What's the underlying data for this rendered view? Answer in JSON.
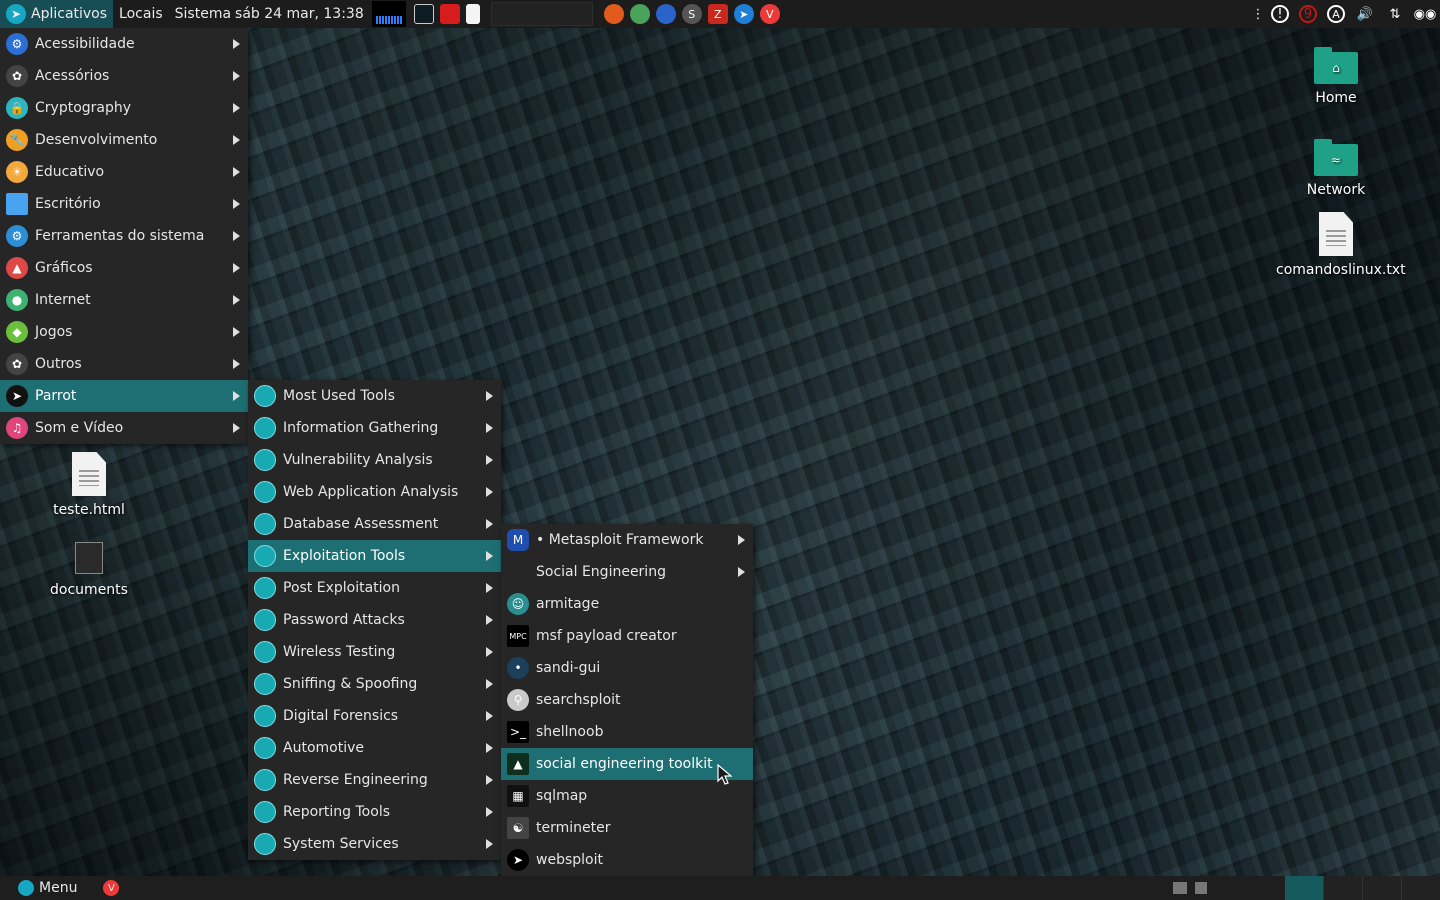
{
  "top_panel": {
    "apps_label": "Aplicativos",
    "places_label": "Locais",
    "system_label": "Sistema",
    "clock": "sáb 24 mar, 13:38",
    "launchers": [
      "firefox-icon",
      "globe-icon",
      "network-icon",
      "s-icon",
      "filezilla-icon",
      "shuttle-icon",
      "vivaldi-icon"
    ],
    "tray": [
      "more-icon",
      "info-icon",
      "notification-icon",
      "accessibility-icon",
      "volume-icon",
      "network-arrows-icon",
      "user-icon"
    ],
    "tray_badge": "9"
  },
  "main_menu": {
    "items": [
      {
        "label": "Acessibilidade",
        "icon": "accessibility-icon",
        "color": "#2a6fd6"
      },
      {
        "label": "Acessórios",
        "icon": "accessories-icon",
        "color": "#444"
      },
      {
        "label": "Cryptography",
        "icon": "lock-icon",
        "color": "#2bb5c0"
      },
      {
        "label": "Desenvolvimento",
        "icon": "wrench-icon",
        "color": "#f0a020"
      },
      {
        "label": "Educativo",
        "icon": "education-icon",
        "color": "#f3a83c"
      },
      {
        "label": "Escritório",
        "icon": "document-icon",
        "color": "#4aa3f0"
      },
      {
        "label": "Ferramentas do sistema",
        "icon": "gear-icon",
        "color": "#2b8ed6"
      },
      {
        "label": "Gráficos",
        "icon": "graphics-icon",
        "color": "#e04848"
      },
      {
        "label": "Internet",
        "icon": "globe-icon",
        "color": "#3cb371"
      },
      {
        "label": "Jogos",
        "icon": "gamepad-icon",
        "color": "#6cbf3c"
      },
      {
        "label": "Outros",
        "icon": "other-icon",
        "color": "#444"
      },
      {
        "label": "Parrot",
        "icon": "parrot-icon",
        "color": "#111"
      },
      {
        "label": "Som e Vídeo",
        "icon": "music-icon",
        "color": "#e0457b"
      }
    ]
  },
  "parrot_menu": {
    "items": [
      {
        "label": "Most Used Tools"
      },
      {
        "label": "Information Gathering"
      },
      {
        "label": "Vulnerability Analysis"
      },
      {
        "label": "Web Application Analysis"
      },
      {
        "label": "Database Assessment"
      },
      {
        "label": "Exploitation Tools"
      },
      {
        "label": "Post Exploitation"
      },
      {
        "label": "Password Attacks"
      },
      {
        "label": "Wireless Testing"
      },
      {
        "label": "Sniffing & Spoofing"
      },
      {
        "label": "Digital Forensics"
      },
      {
        "label": "Automotive"
      },
      {
        "label": "Reverse Engineering"
      },
      {
        "label": "Reporting Tools"
      },
      {
        "label": "System Services"
      }
    ]
  },
  "exploitation_menu": {
    "items": [
      {
        "label": "• Metasploit Framework",
        "icon": "metasploit-icon",
        "submenu": true
      },
      {
        "label": "Social Engineering",
        "icon": "",
        "submenu": true
      },
      {
        "label": "armitage",
        "icon": "armitage-icon",
        "submenu": false
      },
      {
        "label": "msf payload creator",
        "icon": "mpc-icon",
        "submenu": false
      },
      {
        "label": "sandi-gui",
        "icon": "sandi-icon",
        "submenu": false
      },
      {
        "label": "searchsploit",
        "icon": "magnifier-icon",
        "submenu": false
      },
      {
        "label": "shellnoob",
        "icon": "terminal-icon",
        "submenu": false
      },
      {
        "label": "social engineering toolkit",
        "icon": "set-icon",
        "submenu": false
      },
      {
        "label": "sqlmap",
        "icon": "sqlmap-icon",
        "submenu": false
      },
      {
        "label": "termineter",
        "icon": "termineter-icon",
        "submenu": false
      },
      {
        "label": "websploit",
        "icon": "websploit-icon",
        "submenu": false
      }
    ]
  },
  "desktop": {
    "home_label": "Home",
    "network_label": "Network",
    "comandos_label": "comandoslinux.txt",
    "teste_label": "teste.html",
    "documents_label": "documents"
  },
  "bottom_panel": {
    "menu_label": "Menu"
  },
  "colors": {
    "highlight": "#1d6f73",
    "menu_bg": "#262626",
    "panel_bg": "#1c1c1c",
    "accent": "#18a9b3"
  }
}
